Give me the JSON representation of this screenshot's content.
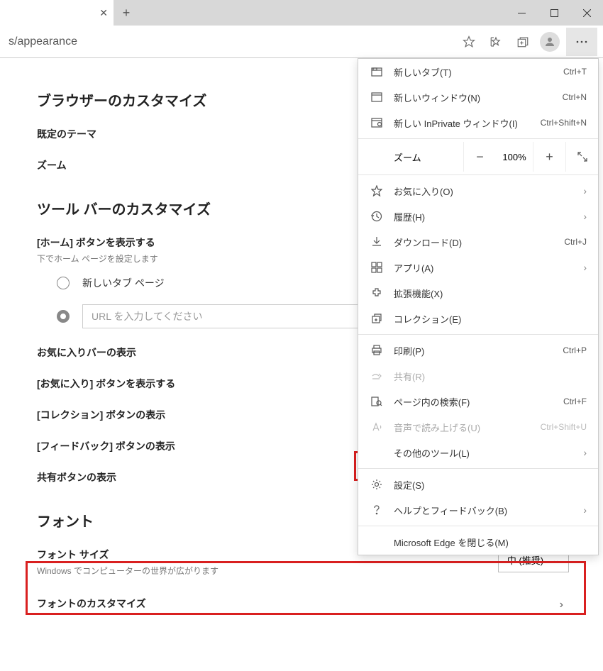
{
  "url": "s/appearance",
  "page": {
    "title_browser": "ブラウザーのカスタマイズ",
    "default_theme": "既定のテーマ",
    "zoom": "ズーム",
    "toolbar_title": "ツール バーのカスタマイズ",
    "home_btn": "[ホーム] ボタンを表示する",
    "home_sub": "下でホーム ページを設定します",
    "radio_newtab": "新しいタブ ページ",
    "url_placeholder": "URL を入力してください",
    "favbar": "お気に入りバーの表示",
    "favbtn": "[お気に入り] ボタンを表示する",
    "collbtn": "[コレクション] ボタンの表示",
    "feedbtn": "[フィードバック] ボタンの表示",
    "sharebtn": "共有ボタンの表示",
    "font_title": "フォント",
    "font_size": "フォント サイズ",
    "font_sub": "Windows でコンピューターの世界が広がります",
    "font_value": "中 (推奨)",
    "font_customize": "フォントのカスタマイズ"
  },
  "menu": {
    "newtab": "新しいタブ(T)",
    "newtab_k": "Ctrl+T",
    "newwin": "新しいウィンドウ(N)",
    "newwin_k": "Ctrl+N",
    "inpriv": "新しい InPrivate ウィンドウ(I)",
    "inpriv_k": "Ctrl+Shift+N",
    "zoom": "ズーム",
    "zoom_val": "100%",
    "fav": "お気に入り(O)",
    "history": "履歴(H)",
    "download": "ダウンロード(D)",
    "download_k": "Ctrl+J",
    "apps": "アプリ(A)",
    "ext": "拡張機能(X)",
    "coll": "コレクション(E)",
    "print": "印刷(P)",
    "print_k": "Ctrl+P",
    "share": "共有(R)",
    "find": "ページ内の検索(F)",
    "find_k": "Ctrl+F",
    "read": "音声で読み上げる(U)",
    "read_k": "Ctrl+Shift+U",
    "othertools": "その他のツール(L)",
    "settings": "設定(S)",
    "help": "ヘルプとフィードバック(B)",
    "close": "Microsoft Edge を閉じる(M)"
  }
}
